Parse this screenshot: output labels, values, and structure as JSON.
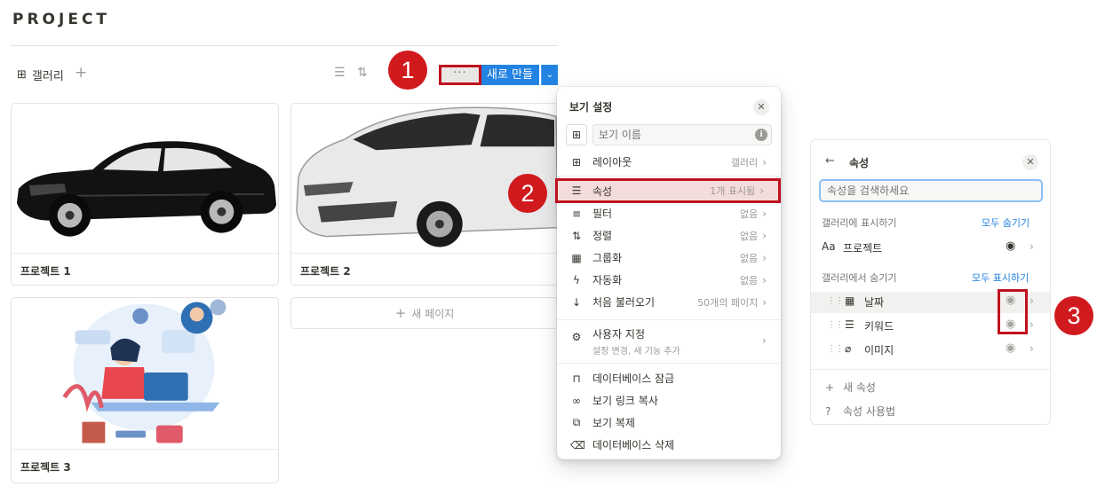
{
  "page": {
    "title": "PROJECT"
  },
  "toolbar": {
    "view_tab_label": "갤러리",
    "add_view": "+",
    "more_label": "···",
    "new_label": "새로 만들기",
    "new_caret": "⌄"
  },
  "steps": [
    "1",
    "2",
    "3"
  ],
  "cards": [
    {
      "title": "프로젝트 1"
    },
    {
      "title": "프로젝트 2"
    },
    {
      "title": "프로젝트 3"
    }
  ],
  "new_page": {
    "plus": "+",
    "label": "새 페이지"
  },
  "view_settings": {
    "title": "보기 설정",
    "name_placeholder": "보기 이름",
    "rows": [
      {
        "icon": "layout-icon",
        "glyph": "▦",
        "label": "레이아웃",
        "value": "갤러리"
      },
      {
        "icon": "list-icon",
        "glyph": "☰",
        "label": "속성",
        "value": "1개 표시됨"
      },
      {
        "icon": "filter-icon",
        "glyph": "≡",
        "label": "필터",
        "value": "없음"
      },
      {
        "icon": "sort-icon",
        "glyph": "⇅",
        "label": "정렬",
        "value": "없음"
      },
      {
        "icon": "group-icon",
        "glyph": "▤",
        "label": "그룹화",
        "value": "없음"
      },
      {
        "icon": "bolt-icon",
        "glyph": "ϟ",
        "label": "자동화",
        "value": "없음"
      },
      {
        "icon": "arrow-down-icon",
        "glyph": "↓",
        "label": "처음 불러오기",
        "value": "50개의 페이지"
      }
    ],
    "customize": {
      "label": "사용자 지정",
      "sub": "설정 변경, 새 기능 추가"
    },
    "actions": [
      {
        "icon": "lock-icon",
        "glyph": "🔒",
        "label": "데이터베이스 잠금"
      },
      {
        "icon": "link-icon",
        "glyph": "🔗",
        "label": "보기 링크 복사"
      },
      {
        "icon": "duplicate-icon",
        "glyph": "⧉",
        "label": "보기 복제"
      },
      {
        "icon": "trash-icon",
        "glyph": "🗑",
        "label": "데이터베이스 삭제"
      }
    ]
  },
  "properties": {
    "title": "속성",
    "search_placeholder": "속성을 검색하세요",
    "shown_section": "갤러리에 표시하기",
    "hide_all": "모두 숨기기",
    "shown_items": [
      {
        "glyph": "Aa",
        "label": "프로젝트"
      }
    ],
    "hidden_section": "갤러리에서 숨기기",
    "show_all": "모두 표시하기",
    "hidden_items": [
      {
        "glyph": "▦",
        "label": "날짜"
      },
      {
        "glyph": "☰",
        "label": "키워드"
      },
      {
        "glyph": "⌀",
        "label": "이미지"
      }
    ],
    "new_property": "새 속성",
    "help": "속성 사용법"
  },
  "colors": {
    "accent": "#2383e2",
    "callout_red": "#d11a1e",
    "highlight_border": "#c0101f"
  }
}
